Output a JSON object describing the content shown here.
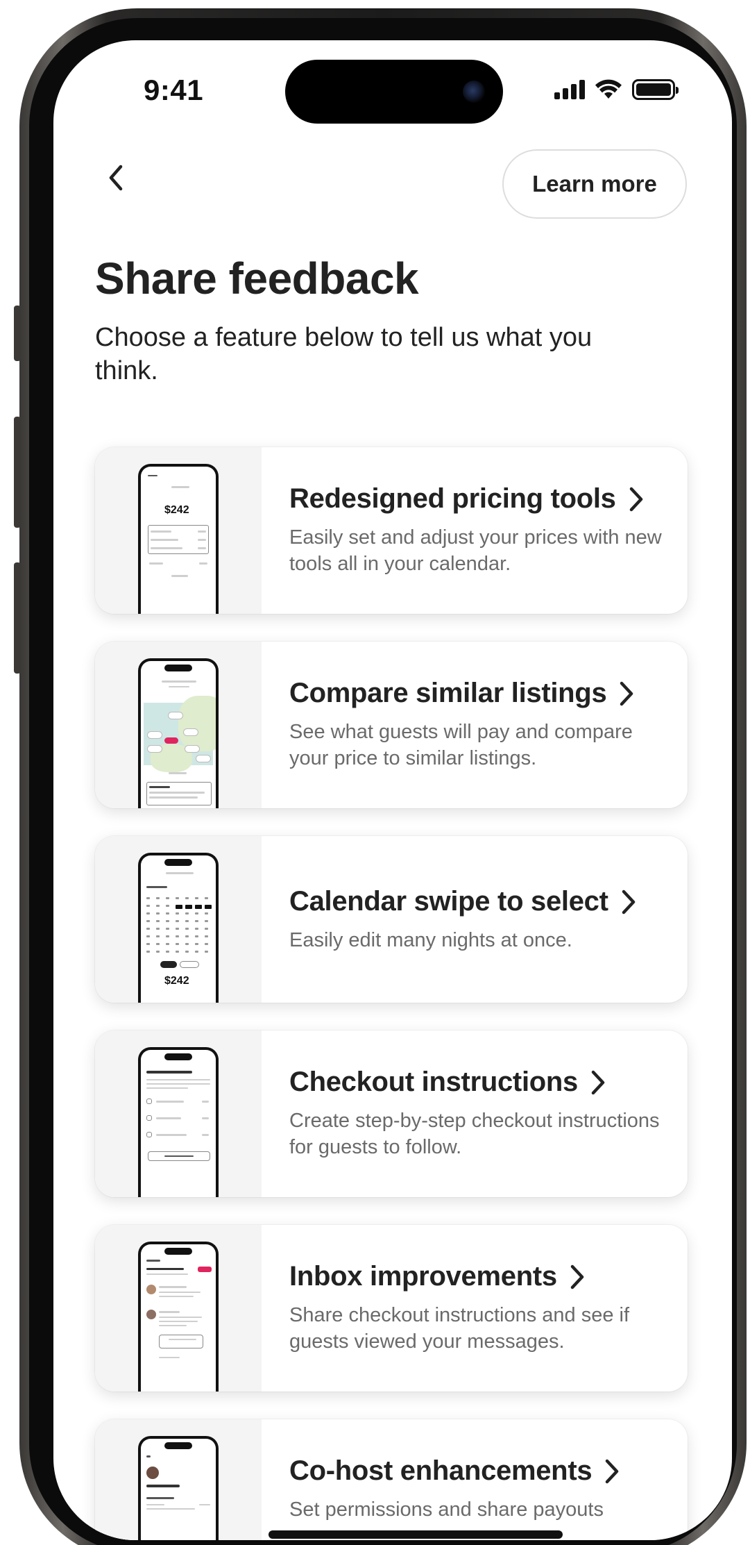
{
  "status_bar": {
    "time": "9:41",
    "battery_level": 1.0
  },
  "header": {
    "back_icon": "chevron-left-icon",
    "learn_more_label": "Learn more"
  },
  "page": {
    "title": "Share feedback",
    "subtitle": "Choose a feature below to tell us what you think."
  },
  "features": [
    {
      "title": "Redesigned pricing tools",
      "description": "Easily set and adjust your prices with new tools all in your calendar.",
      "thumb_price": "$242"
    },
    {
      "title": "Compare similar listings",
      "description": "See what guests will pay and compare your price to similar listings."
    },
    {
      "title": "Calendar swipe to select",
      "description": "Easily edit many nights at once.",
      "thumb_price": "$242"
    },
    {
      "title": "Checkout instructions",
      "description": "Create step-by-step checkout instructions for guests to follow."
    },
    {
      "title": "Inbox improvements",
      "description": "Share checkout instructions and see if guests viewed your messages."
    },
    {
      "title": "Co-host enhancements",
      "description": "Set permissions and share payouts"
    }
  ],
  "colors": {
    "accent": "#e0245e",
    "text": "#222222",
    "muted": "#6a6a6a"
  }
}
